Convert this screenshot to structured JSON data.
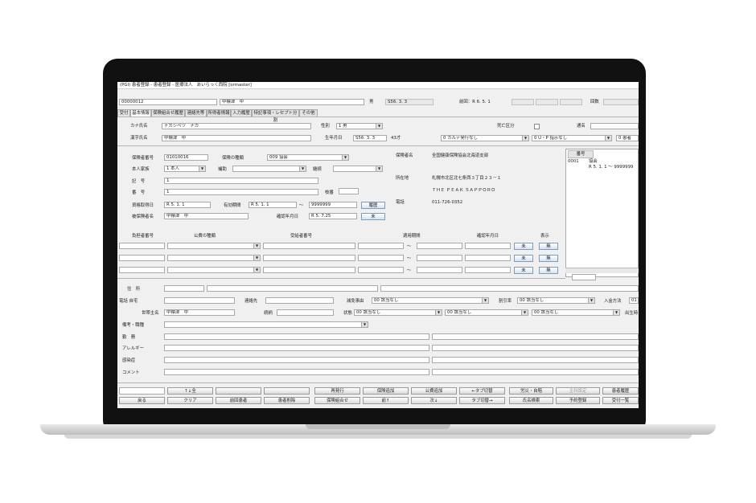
{
  "window": {
    "title": "(PGI) 患者登録 - 患者登録 - 医療法人　あいらっく西院 [ormaster]"
  },
  "header": {
    "patient_id": "00000012",
    "name": "中標津　中",
    "sex": "男",
    "birthdate": "S56. 3. 3",
    "prev_visit_label": "前回：R 6. 5. 1",
    "kaisu_label": "回数"
  },
  "tabs": [
    "受付",
    "基本情報",
    "保険組合せ履歴",
    "連絡先等",
    "所得者情報",
    "入力履歴",
    "特記事項・レセプト分割",
    "その他"
  ],
  "basic": {
    "kana_label": "カナ氏名",
    "kana_value": "ナカシベツ　ナカ",
    "kanji_label": "漢字氏名",
    "kanji_value": "中標津　中",
    "sex_label": "性別",
    "sex_value": "1 男",
    "birth_label": "生年月日",
    "birth_value": "S56. 3. 3",
    "age_value": "43才",
    "karte_value": "0 カルテ発行なし",
    "death_label": "死亡区分",
    "tsumei_label": "通名",
    "ukeire_value": "0 U・P 指示なし",
    "ijyo_value": "0 患者"
  },
  "insurance": {
    "hokensha_no_label": "保険者番号",
    "hokensha_no_value": "01010016",
    "type_label": "保険の種類",
    "type_value": "009 協会",
    "honnin_label": "本人家族",
    "honnin_value": "1 本人",
    "hojo_label": "補助",
    "keizoku_label": "継続",
    "kigo_label": "記　号",
    "kigo_value": "1",
    "bango_label": "番　号",
    "bango_value": "1",
    "edaban_label": "枝番",
    "shikaku_label": "資格取得日",
    "shikaku_value": "R 5. 1. 1",
    "yuko_label": "有効期間",
    "yuko_from": "R 5. 1. 1",
    "tilde": "～",
    "yuko_to": "9999999",
    "rireki_button": "履歴",
    "hihokensha_label": "被保険者名",
    "hihokensha_value": "中標津　中",
    "kakunin_label": "確認年月日",
    "kakunin_value": "R 5. 7.25",
    "mi_button": "未",
    "hokenja_name_label": "保険者名",
    "hokenja_name_value": "全国健康保険協会北海道支部",
    "address_label": "所在地",
    "address_line1": "札幌市北区北七条西３丁目２３－１",
    "address_line2": "ＴＨＥ ＰＥＡＫ ＳＡＰＰＯＲＯ",
    "tel_label": "電話",
    "tel_value": "011-726-0352"
  },
  "side_list": {
    "col_label": "番号",
    "rows": [
      {
        "no": "0001",
        "name": "協会",
        "period": "R 5. 1. 1 ～ 9999999"
      }
    ]
  },
  "kohi": {
    "headers": [
      "負担者番号",
      "公費の種類",
      "受給者番号",
      "適用期間",
      "確認年月日",
      "表示"
    ],
    "mi": "未",
    "mu": "無",
    "tilde": "～"
  },
  "contact": {
    "jusho_label": "住　所",
    "tel_label": "電話 自宅",
    "renraku_label": "連絡先",
    "gensan_label": "減免事由",
    "gensan_value": "00 該当なし",
    "waribiki_label": "割引率",
    "waribiki_value": "00 該当なし",
    "nyukin_label": "入金方法",
    "nyukin_value": "01",
    "setainushi_label": "世帯主名",
    "setainushi_value": "中標津　中",
    "zokugara_label": "続柄",
    "jotai_label": "状態",
    "jotai_value1": "00 該当なし",
    "jotai_value2": "00 該当なし",
    "jotai_value3": "00 該当なし",
    "shutsuryoku_label": "出生時",
    "bikou_label": "備考・職種",
    "kinmu_label": "勤　務",
    "allergy_label": "アレルギー",
    "kansen_label": "感染症",
    "comment_label": "コメント"
  },
  "footer": {
    "row1": [
      "",
      "↑↓全",
      "",
      "",
      "再発行",
      "保険追加",
      "公費追加",
      "←タブ切替",
      "労災・自賠",
      "主科設定",
      "患者履歴"
    ],
    "row2": [
      "戻る",
      "クリア",
      "前回患者",
      "患者削除",
      "保険組合せ",
      "前↑",
      "次↓",
      "タブ切替→",
      "氏名検索",
      "予約登録",
      "受付一覧"
    ]
  }
}
